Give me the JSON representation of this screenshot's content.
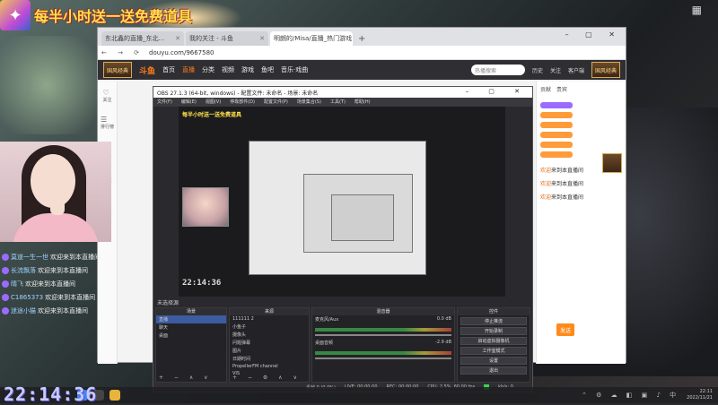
{
  "overlay": {
    "slogan": "每半小时送一送免费道具",
    "logo_char": "✦",
    "top_right_icon": "grid-icon"
  },
  "browser": {
    "tabs": [
      {
        "label": "东北鑫的直播_东北...",
        "active": false
      },
      {
        "label": "我的关注 - 斗鱼",
        "active": false
      },
      {
        "label": "明朗的/Misa/直播_热门游戏",
        "active": true
      }
    ],
    "new_tab": "+",
    "window_controls": "– ▢ ✕",
    "nav_buttons": "← → ⟳",
    "url": "douyu.com/9667580"
  },
  "site": {
    "logo": "斗鱼",
    "nav": [
      {
        "label": "首页",
        "active": false
      },
      {
        "label": "直播",
        "active": true
      },
      {
        "label": "分类",
        "active": false
      },
      {
        "label": "视频",
        "active": false
      },
      {
        "label": "游戏",
        "active": false
      },
      {
        "label": "鱼吧",
        "active": false
      },
      {
        "label": "音乐·戏曲",
        "active": false
      }
    ],
    "search_placeholder": "热播搜索",
    "header_links": [
      "历史",
      "关注",
      "客户端"
    ],
    "banner_left": "国风经典",
    "banner_right": "国风经典",
    "rail_items": [
      "关注",
      "排行榜",
      "分区",
      "话题",
      "设置"
    ]
  },
  "right_panel": {
    "tabs": [
      "贡献",
      "贵宾"
    ],
    "msgs": [
      {
        "name": "欢迎",
        "text": "来到本直播间"
      },
      {
        "name": "欢迎",
        "text": "来到本直播间"
      },
      {
        "name": "欢迎",
        "text": "来到本直播间"
      }
    ],
    "send": "发送"
  },
  "obs": {
    "title": "OBS 27.1.3 (64-bit, windows) - 配置文件: 未命名 - 场景: 未命名",
    "window_controls": "– ▢ ✕",
    "menu": [
      "文件(F)",
      "编辑(E)",
      "视图(V)",
      "停靠部件(D)",
      "配置文件(P)",
      "场景集合(S)",
      "工具(T)",
      "帮助(H)"
    ],
    "mode_label": "未选择源",
    "preview_slogan": "每半小时送一送免费道具",
    "preview_clock": "22:14:36",
    "docks": {
      "scenes": {
        "header": "场景",
        "rows": [
          "直播",
          "聊天",
          "桌面"
        ],
        "footer": "+ − ∧ ∨"
      },
      "sources": {
        "header": "来源",
        "rows": [
          "111111 2",
          "小鱼子",
          "摄像头",
          "问题弹幕",
          "图片",
          "日期时间",
          "PropellerFM channel",
          "VIS",
          "问题的翻译"
        ],
        "footer": "+ − ⚙ ∧ ∨"
      },
      "mixer": {
        "header": "混音器",
        "channels": [
          {
            "name": "麦克风/Aux",
            "db": "0.0 dB"
          },
          {
            "name": "桌面音频",
            "db": "-2.9 dB"
          }
        ]
      },
      "controls": {
        "header": "控件",
        "buttons": [
          "停止推流",
          "开始录制",
          "启动虚拟摄像机",
          "工作室模式",
          "设置",
          "退出"
        ]
      }
    },
    "status": {
      "dropped": "丢帧 0 (0.0%)",
      "live": "LIVE: 00:00:00",
      "rec": "REC: 00:00:00",
      "cpu": "CPU: 2.5%, 60.00 fps",
      "kbps": "kb/s: 0"
    }
  },
  "chat": [
    {
      "nick": "莫道一生一世",
      "text": "欢迎来到本直播间"
    },
    {
      "nick": "长流飘落",
      "text": "欢迎来到本直播间"
    },
    {
      "nick": "晴飞",
      "text": "欢迎来到本直播间"
    },
    {
      "nick": "C1865373",
      "text": "欢迎来到本直播间"
    },
    {
      "nick": "迷途小猫",
      "text": "欢迎来到本直播间"
    }
  ],
  "clock": "22:14:36",
  "taskbar": {
    "time": "22:11",
    "date": "2022/11/21",
    "tray_icons": "⌃ ⚙ ☁ ◧ ▣ ♪ 中"
  }
}
